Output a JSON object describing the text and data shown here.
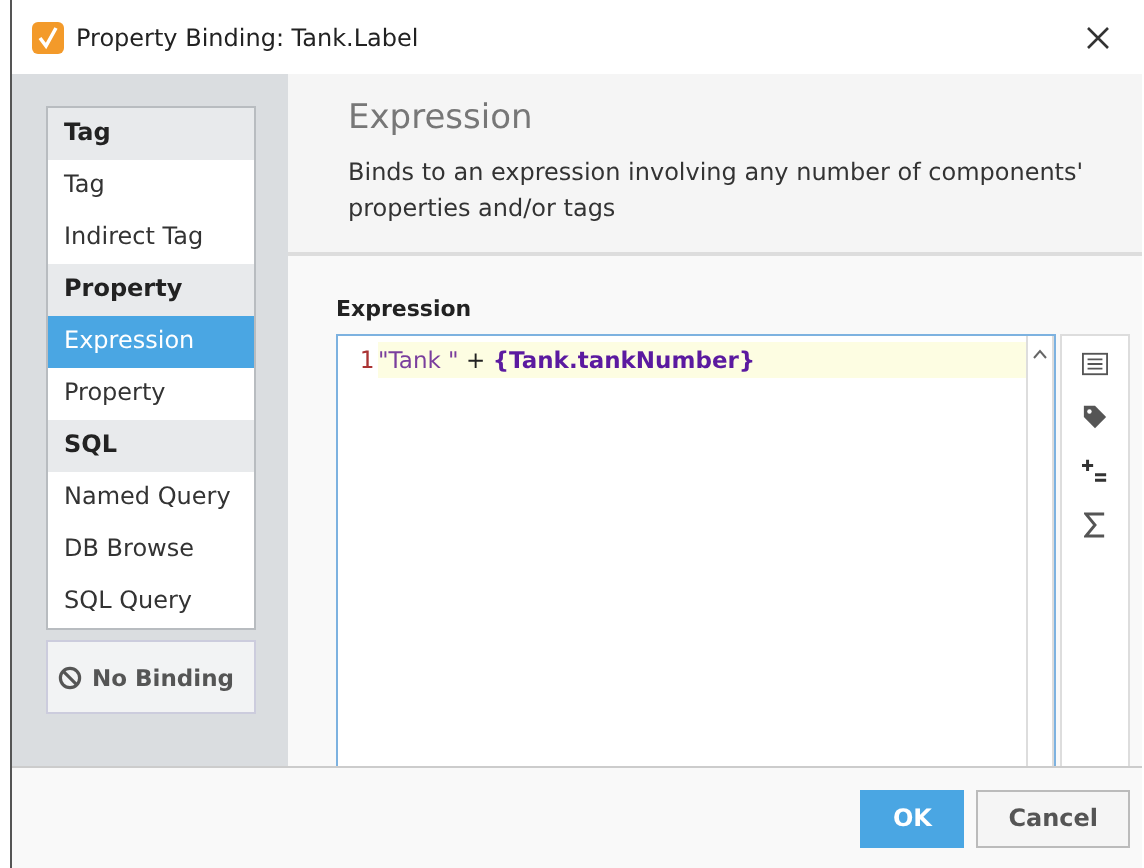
{
  "window": {
    "title": "Property Binding: Tank.Label"
  },
  "sidebar": {
    "groups": [
      {
        "title": "Tag",
        "items": [
          {
            "label": "Tag",
            "selected": false
          },
          {
            "label": "Indirect Tag",
            "selected": false
          }
        ]
      },
      {
        "title": "Property",
        "items": [
          {
            "label": "Expression",
            "selected": true
          },
          {
            "label": "Property",
            "selected": false
          }
        ]
      },
      {
        "title": "SQL",
        "items": [
          {
            "label": "Named Query",
            "selected": false
          },
          {
            "label": "DB Browse",
            "selected": false
          },
          {
            "label": "SQL Query",
            "selected": false
          }
        ]
      }
    ],
    "no_binding_button": "No Binding"
  },
  "panel": {
    "title": "Expression",
    "description": "Binds to an expression involving any number of components' properties and/or tags"
  },
  "editor": {
    "label": "Expression",
    "lines": [
      {
        "number": "1",
        "tokens": [
          {
            "kind": "string",
            "text": "\"Tank \""
          },
          {
            "kind": "operator",
            "text": " + "
          },
          {
            "kind": "reference",
            "text": "{Tank.tankNumber}"
          }
        ]
      }
    ]
  },
  "buttons": [
    {
      "label": "OK",
      "kind": "primary"
    },
    {
      "label": "Cancel",
      "kind": "secondary"
    }
  ]
}
